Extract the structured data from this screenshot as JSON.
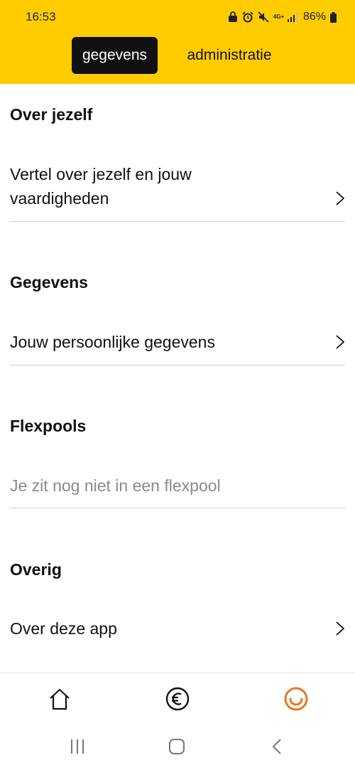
{
  "status_bar": {
    "time": "16:53",
    "network": "4G+",
    "battery": "86%"
  },
  "tabs": [
    {
      "label": "gegevens",
      "active": true
    },
    {
      "label": "administratie",
      "active": false
    }
  ],
  "sections": {
    "about": {
      "title": "Over jezelf",
      "item_line1": "Vertel over jezelf en jouw",
      "item_line2": "vaardigheden"
    },
    "details": {
      "title": "Gegevens",
      "item": "Jouw persoonlijke gegevens"
    },
    "flexpools": {
      "title": "Flexpools",
      "empty_text": "Je zit nog niet in een flexpool"
    },
    "other": {
      "title": "Overig",
      "item": "Over deze app"
    }
  },
  "bottom_nav": {
    "items": [
      "home-icon",
      "euro-icon",
      "profile-smile-icon"
    ],
    "active": "profile-smile-icon"
  },
  "colors": {
    "header_background": "#FFCC00",
    "active_tab": "#111111",
    "accent": "#E87722"
  }
}
